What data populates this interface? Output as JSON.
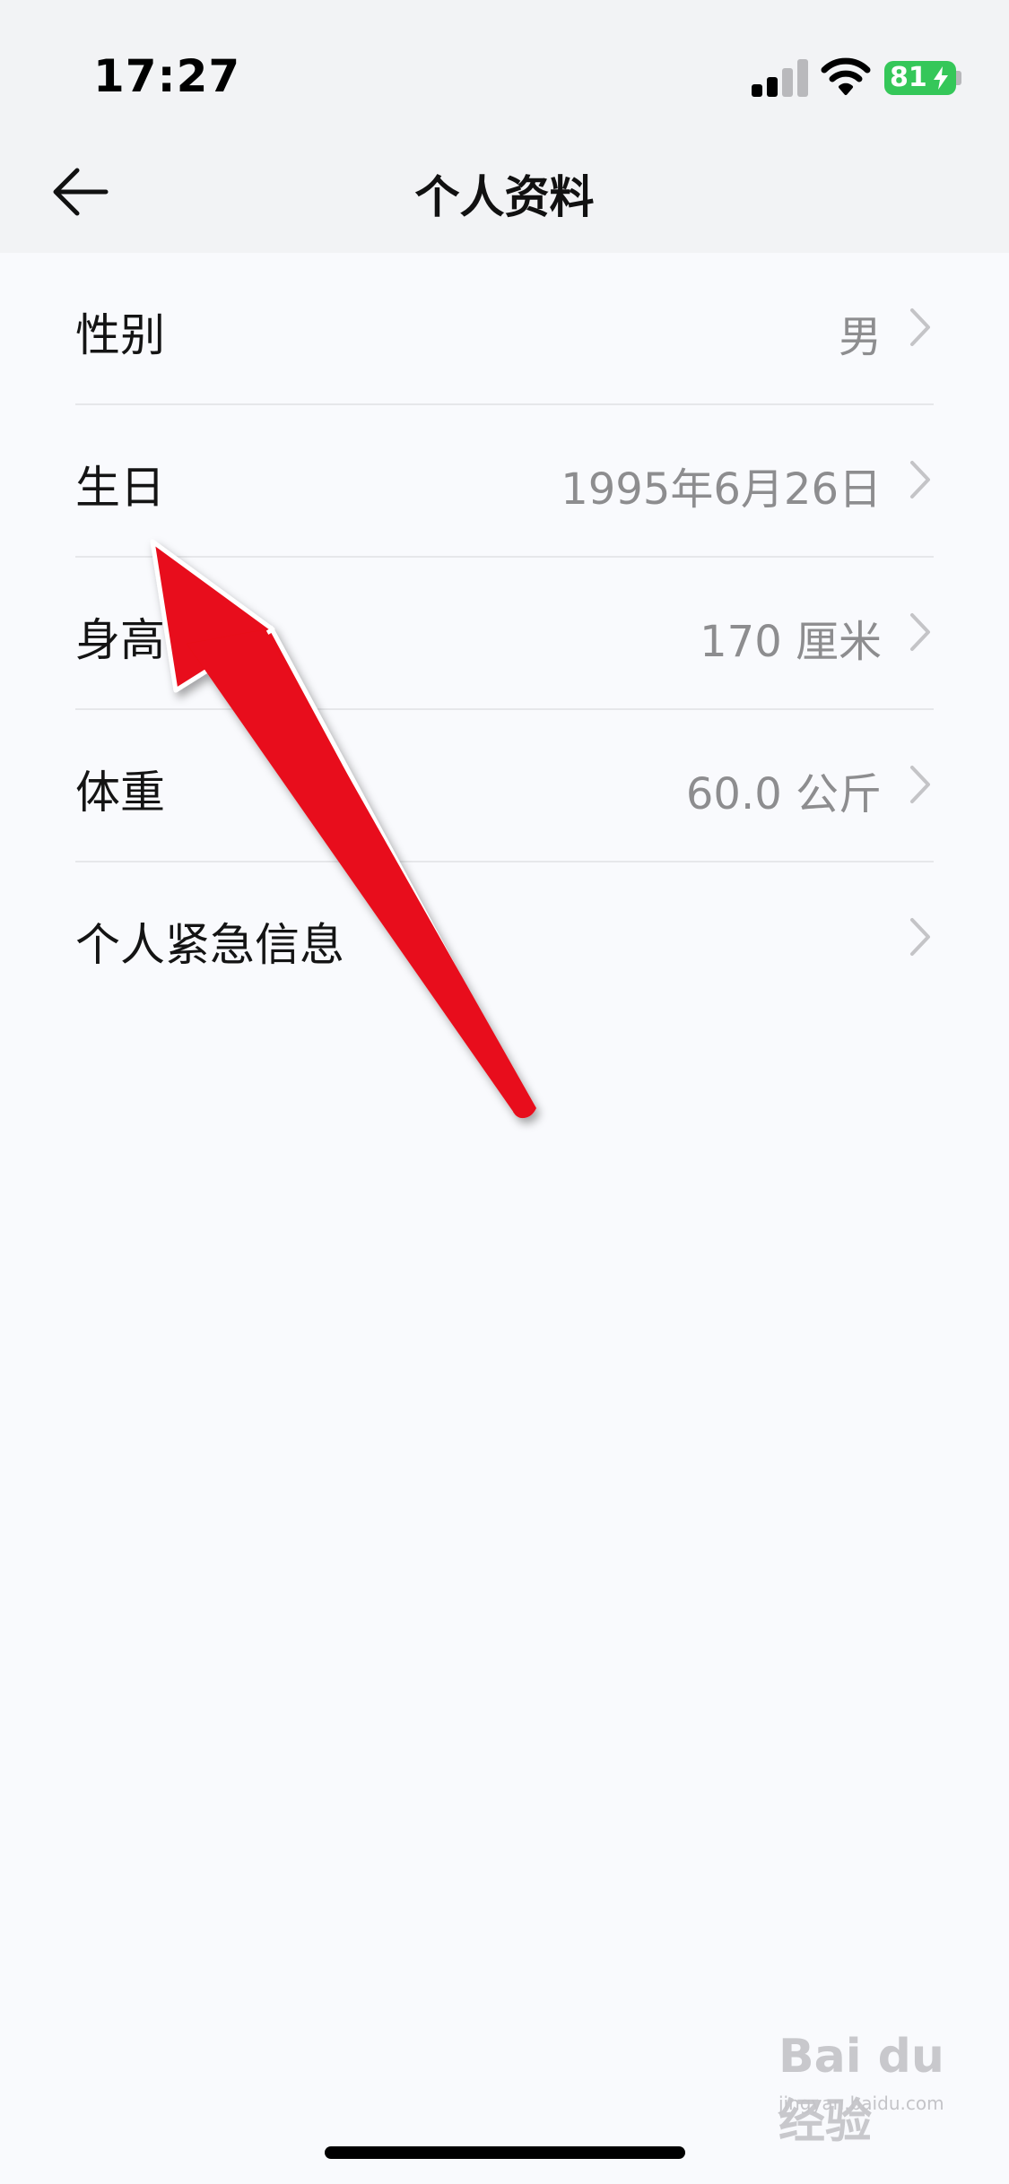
{
  "status_bar": {
    "time": "17:27",
    "battery": "81",
    "icons": [
      "signal-icon",
      "wifi-icon",
      "battery-icon",
      "charging-bolt-icon"
    ]
  },
  "nav": {
    "title": "个人资料",
    "back_icon": "back-arrow-icon"
  },
  "rows": [
    {
      "label": "性别",
      "value": "男"
    },
    {
      "label": "生日",
      "value": "1995年6月26日"
    },
    {
      "label": "身高",
      "value": "170 厘米"
    },
    {
      "label": "体重",
      "value": "60.0 公斤"
    },
    {
      "label": "个人紧急信息",
      "value": ""
    }
  ],
  "watermark": {
    "text": "Bai du 经验",
    "url": "jingyan.baidu.com"
  },
  "colors": {
    "background": "#f9fafd",
    "header_background": "#f2f3f5",
    "battery_green": "#35c759",
    "annotation_arrow": "#e8101a",
    "value_text": "#8d8d8f"
  }
}
